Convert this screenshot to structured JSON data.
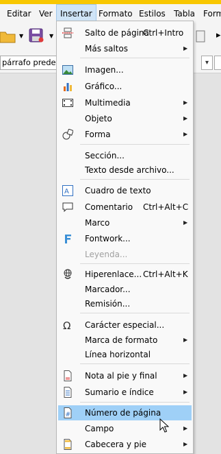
{
  "menubar": {
    "items": [
      "Editar",
      "Ver",
      "Insertar",
      "Formato",
      "Estilos",
      "Tabla",
      "Form"
    ]
  },
  "toolbar": {
    "paragraph_style": "párrafo predet"
  },
  "menu": {
    "items": [
      {
        "label": "Salto de página",
        "shortcut": "Ctrl+Intro",
        "icon": "page-break-icon"
      },
      {
        "label": "Más saltos",
        "submenu": true
      },
      {
        "label": "Imagen...",
        "icon": "image-icon"
      },
      {
        "label": "Gráfico...",
        "icon": "chart-icon"
      },
      {
        "label": "Multimedia",
        "submenu": true,
        "icon": "media-icon"
      },
      {
        "label": "Objeto",
        "submenu": true
      },
      {
        "label": "Forma",
        "submenu": true,
        "icon": "shape-icon"
      },
      {
        "label": "Sección..."
      },
      {
        "label": "Texto desde archivo..."
      },
      {
        "label": "Cuadro de texto",
        "icon": "text-box-icon"
      },
      {
        "label": "Comentario",
        "shortcut": "Ctrl+Alt+C",
        "icon": "comment-icon"
      },
      {
        "label": "Marco",
        "submenu": true
      },
      {
        "label": "Fontwork...",
        "icon": "fontwork-icon"
      },
      {
        "label": "Leyenda...",
        "disabled": true
      },
      {
        "label": "Hiperenlace...",
        "shortcut": "Ctrl+Alt+K",
        "icon": "hyperlink-icon"
      },
      {
        "label": "Marcador..."
      },
      {
        "label": "Remisión..."
      },
      {
        "label": "Carácter especial...",
        "icon": "special-character-icon"
      },
      {
        "label": "Marca de formato",
        "submenu": true
      },
      {
        "label": "Línea horizontal"
      },
      {
        "label": "Nota al pie y final",
        "submenu": true,
        "icon": "footnote-icon"
      },
      {
        "label": "Sumario e índice",
        "submenu": true,
        "icon": "toc-icon"
      },
      {
        "label": "Número de página",
        "icon": "page-number-icon",
        "highlighted": true
      },
      {
        "label": "Campo",
        "submenu": true
      },
      {
        "label": "Cabecera y pie",
        "submenu": true,
        "icon": "header-footer-icon"
      }
    ]
  },
  "colors": {
    "accent": "#f8c700",
    "highlight": "#9fd0f7"
  }
}
